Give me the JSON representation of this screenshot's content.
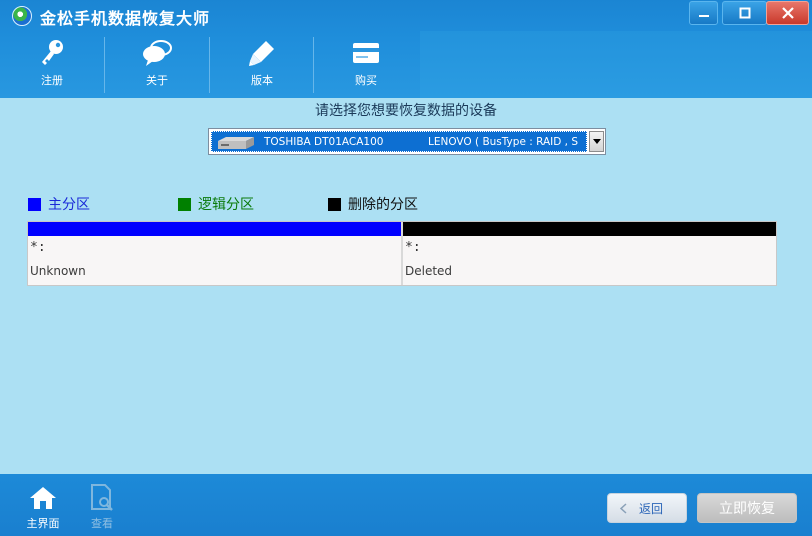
{
  "app": {
    "title": "金松手机数据恢复大师"
  },
  "toolbar": {
    "items": [
      {
        "label": "注册",
        "icon": "key-icon"
      },
      {
        "label": "关于",
        "icon": "chat-bubbles-icon"
      },
      {
        "label": "版本",
        "icon": "pen-icon"
      },
      {
        "label": "购买",
        "icon": "card-icon"
      }
    ]
  },
  "main": {
    "prompt": "请选择您想要恢复数据的设备",
    "device": {
      "name": "TOSHIBA DT01ACA100",
      "info": "LENOVO ( BusType : RAID ,  S"
    },
    "legend": [
      {
        "label": "主分区",
        "color": "#0000ff"
      },
      {
        "label": "逻辑分区",
        "color": "#008000"
      },
      {
        "label": "删除的分区",
        "color": "#000000"
      }
    ],
    "partitions": [
      {
        "fs": "*:",
        "name": "Unknown",
        "color": "#0000ff"
      },
      {
        "fs": "*:",
        "name": "Deleted",
        "color": "#000000"
      }
    ]
  },
  "bottom": {
    "nav": [
      {
        "label": "主界面",
        "icon": "home-icon",
        "active": true
      },
      {
        "label": "查看",
        "icon": "document-search-icon",
        "active": false
      }
    ],
    "back_label": "返回",
    "recover_label": "立即恢复"
  }
}
